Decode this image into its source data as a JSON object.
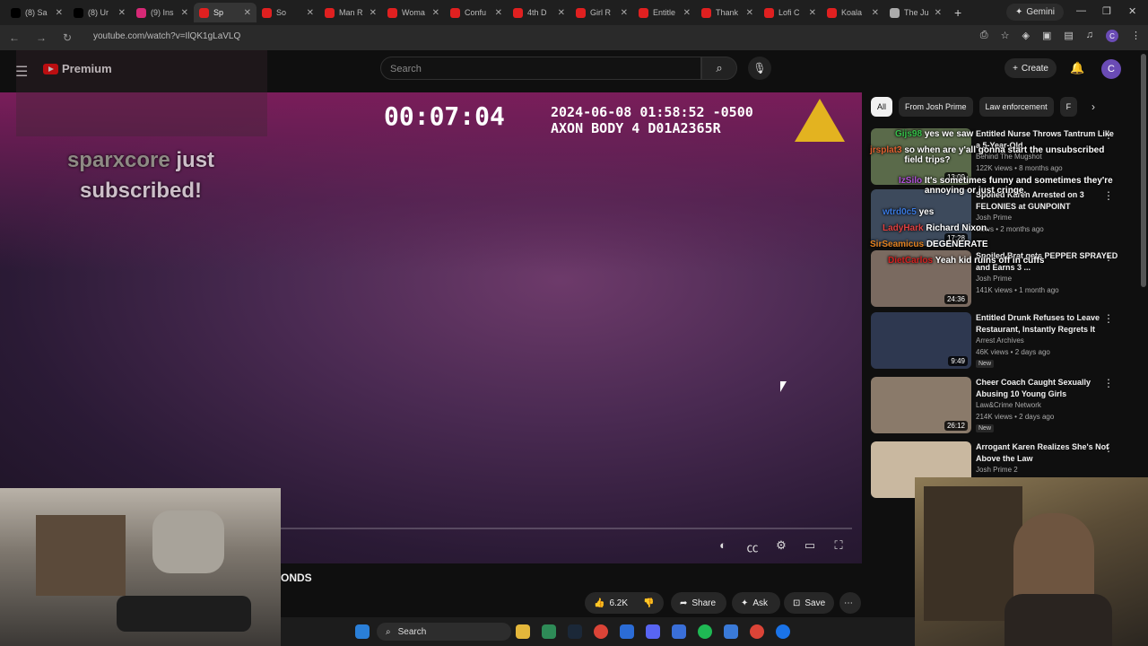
{
  "browser": {
    "tabs": [
      {
        "label": "(8) Sa",
        "color": "#000000"
      },
      {
        "label": "(8) Ur",
        "color": "#000000"
      },
      {
        "label": "(9) Ins",
        "color": "#d62976"
      },
      {
        "label": "Sp",
        "color": "#e02020"
      },
      {
        "label": "So",
        "color": "#e02020"
      },
      {
        "label": "Man R",
        "color": "#e02020"
      },
      {
        "label": "Woma",
        "color": "#e02020"
      },
      {
        "label": "Confu",
        "color": "#e02020"
      },
      {
        "label": "4th D",
        "color": "#e02020"
      },
      {
        "label": "Girl R",
        "color": "#e02020"
      },
      {
        "label": "Entitle",
        "color": "#e02020"
      },
      {
        "label": "Thank",
        "color": "#e02020"
      },
      {
        "label": "Lofi C",
        "color": "#e02020"
      },
      {
        "label": "Koala",
        "color": "#e02020"
      },
      {
        "label": "The Ju",
        "color": "#aaaaaa"
      }
    ],
    "gemini_label": "Gemini",
    "url": "youtube.com/watch?v=IlQK1gLaVLQ",
    "profile_initial": "C"
  },
  "youtube": {
    "logo_label": "Premium",
    "search_placeholder": "Search",
    "create_label": "Create",
    "avatar_initial": "C"
  },
  "player": {
    "timer": "00:07:04",
    "axon_line1": "2024-06-08 01:58:52 -0500",
    "axon_line2": "AXON BODY 4 D01A2365R",
    "sub_name": "sparxcore",
    "sub_rest": "just subscribed!"
  },
  "video": {
    "title_fragment": "ONDS",
    "likes": "6.2K",
    "share_label": "Share",
    "ask_label": "Ask",
    "save_label": "Save"
  },
  "chips": [
    "All",
    "From Josh Prime",
    "Law enforcement",
    "F"
  ],
  "chat": [
    {
      "user": "Gijs98",
      "msg": "yes we saw",
      "color": "#36c24a"
    },
    {
      "user": "jrsplat3",
      "msg": "so when are y'all gonna start the unsubscribed field trips?",
      "color": "#e06030"
    },
    {
      "user": "IzSilo",
      "msg": "It's sometimes funny and sometimes they're annoying or just cringe.",
      "color": "#b04fd8"
    },
    {
      "user": "wtrd0c5",
      "msg": "yes",
      "color": "#3a7ae0"
    },
    {
      "user": "LadyHark",
      "msg": "Richard Nixon.",
      "color": "#e04040"
    },
    {
      "user": "SirSeamicus",
      "msg": "DEGENERATE",
      "color": "#e08020"
    },
    {
      "user": "DietCarlos",
      "msg": "Yeah kid ruins off in cuffs",
      "color": "#d42020"
    }
  ],
  "recommendations": [
    {
      "title": "Entitled Nurse Throws Tantrum Like a 5-Year-Old",
      "channel": "Behind The Mugshot",
      "meta": "122K views • 8 months ago",
      "duration": "13:09",
      "is_new": ""
    },
    {
      "title": "Spoiled Karen Arrested on 3 FELONIES at GUNPOINT",
      "channel": "Josh Prime",
      "meta": "views • 2 months ago",
      "duration": "17:28",
      "is_new": ""
    },
    {
      "title": "Spoiled Brat gets PEPPER SPRAYED and Earns 3 ...",
      "channel": "Josh Prime",
      "meta": "141K views • 1 month ago",
      "duration": "24:36",
      "is_new": ""
    },
    {
      "title": "Entitled Drunk Refuses to Leave Restaurant, Instantly Regrets It",
      "channel": "Arrest Archives",
      "meta": "46K views • 2 days ago",
      "duration": "9:49",
      "is_new": "New"
    },
    {
      "title": "Cheer Coach Caught Sexually Abusing 10 Young Girls",
      "channel": "Law&Crime Network",
      "meta": "214K views • 2 days ago",
      "duration": "26:12",
      "is_new": "New"
    },
    {
      "title": "Arrogant Karen Realizes She's Not Above the Law",
      "channel": "Josh Prime 2",
      "meta": "",
      "duration": "",
      "is_new": ""
    }
  ],
  "taskbar": {
    "search_label": "Search"
  },
  "colors": {
    "accent": "#ff0000",
    "axon": "#e3b320",
    "background": "#0f0f0f"
  }
}
